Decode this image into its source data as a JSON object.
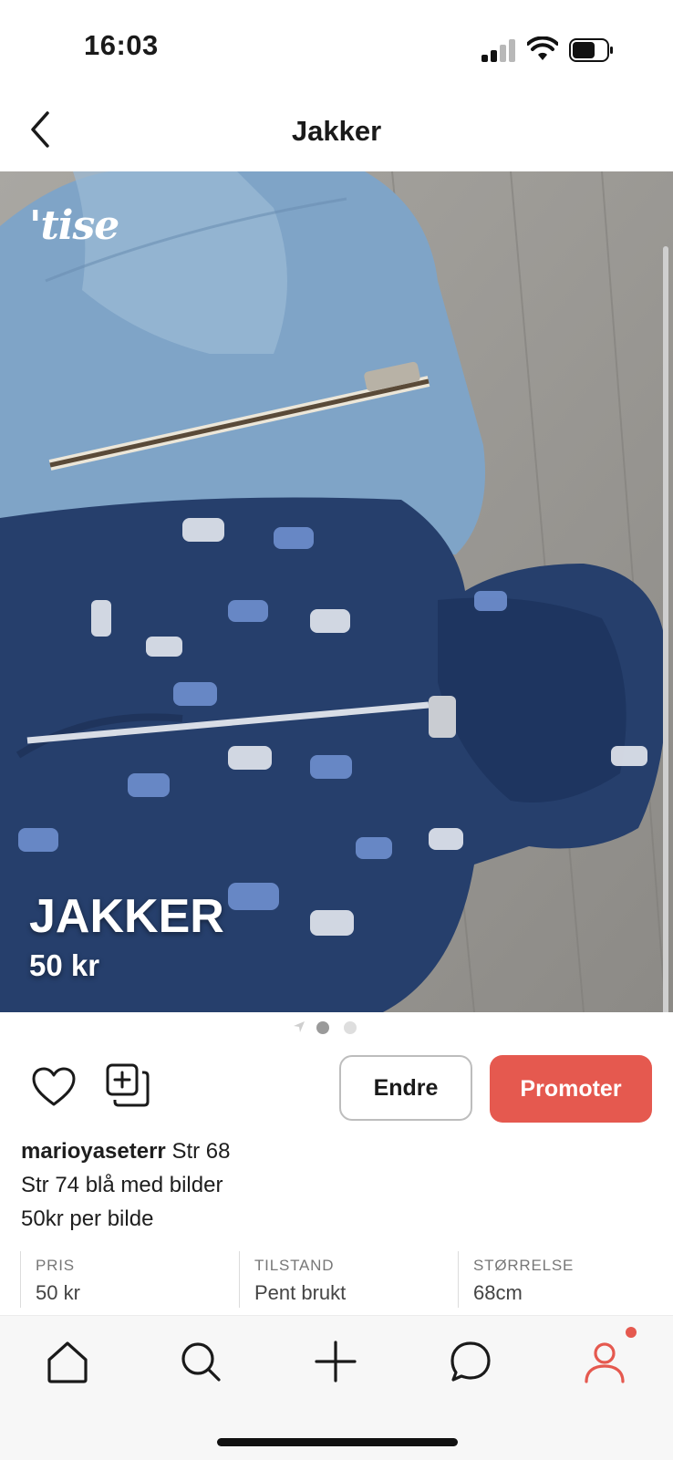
{
  "status_bar": {
    "time": "16:03",
    "icons": [
      "cellular-signal-icon",
      "wifi-icon",
      "battery-icon"
    ]
  },
  "header": {
    "title": "Jakker",
    "back_icon": "chevron-left-icon"
  },
  "listing_image": {
    "watermark": "'tise",
    "overlay_title": "JAKKER",
    "overlay_price": "50 kr",
    "pagination": {
      "total": 2,
      "active": 0
    }
  },
  "actions": {
    "like_icon": "heart-icon",
    "copy_icon": "add-to-collection-icon",
    "edit_label": "Endre",
    "promote_label": "Promoter"
  },
  "description": {
    "username": "marioyaseterr",
    "line1": "Str 68",
    "line2": "Str 74 blå med bilder",
    "line3": "50kr per bilde"
  },
  "details": [
    {
      "label": "PRIS",
      "value": "50 kr"
    },
    {
      "label": "TILSTAND",
      "value": "Pent brukt"
    },
    {
      "label": "STØRRELSE",
      "value": "68cm"
    }
  ],
  "tab_bar": {
    "tabs": [
      {
        "icon": "home-icon"
      },
      {
        "icon": "search-icon"
      },
      {
        "icon": "plus-icon"
      },
      {
        "icon": "chat-bubble-icon"
      },
      {
        "icon": "profile-icon"
      }
    ],
    "active_tab": 4
  },
  "colors": {
    "accent": "#e5594f",
    "text": "#1a1a1a",
    "muted": "#777777",
    "floor": "#9a9894",
    "navy_jacket": "#243f6e",
    "light_jacket": "#7ea3c6"
  }
}
